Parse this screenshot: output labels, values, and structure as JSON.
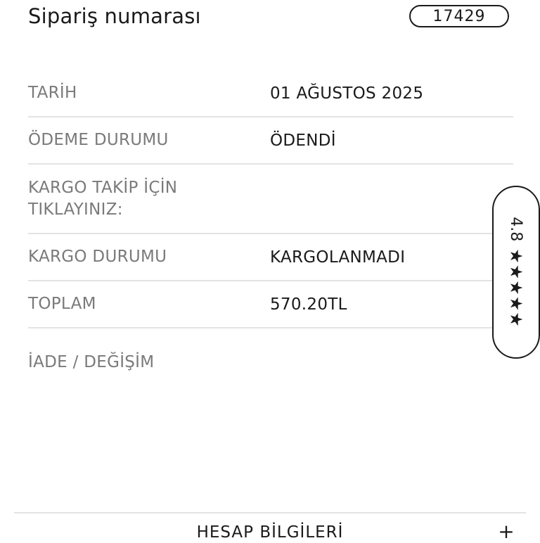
{
  "header": {
    "title": "Sipariş numarası",
    "order_number": "17429"
  },
  "details": [
    {
      "label": "TARİH",
      "value": "01 AĞUSTOS 2025"
    },
    {
      "label": "ÖDEME DURUMU",
      "value": "ÖDENDİ"
    },
    {
      "label": "KARGO TAKİP İÇİN TIKLAYINIZ:",
      "value": ""
    },
    {
      "label": "KARGO DURUMU",
      "value": "KARGOLANMADI"
    },
    {
      "label": "TOPLAM",
      "value": "570.20TL"
    }
  ],
  "return_link": "İADE / DEĞİŞİM",
  "rating": {
    "value": "4.8",
    "stars": "★★★★★"
  },
  "footer": {
    "title": "HESAP BİLGİLERİ",
    "expand_glyph": "+"
  },
  "icons": {
    "expand": "plus-icon",
    "rating": "star-icon"
  }
}
